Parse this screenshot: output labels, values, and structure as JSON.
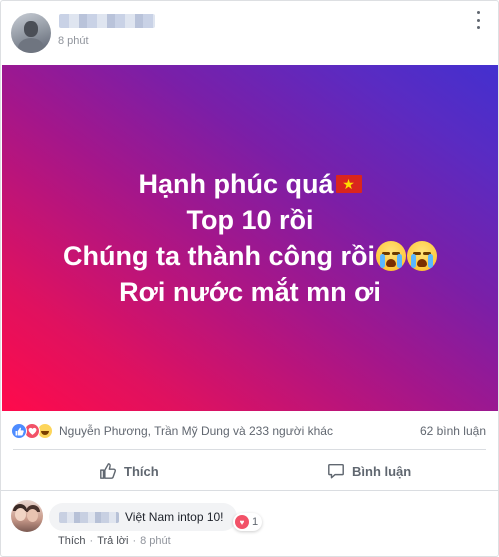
{
  "post": {
    "time": "8 phút",
    "banner_lines": [
      "Hạnh phúc quá",
      "Top 10 rồi",
      "Chúng ta thành công rồi",
      "Rơi nước mắt mn ơi"
    ]
  },
  "reactions": {
    "names": "Nguyễn Phương, Trần Mỹ Dung và 233 người khác",
    "comment_count": "62 bình luận",
    "types": [
      "like-icon",
      "love-icon",
      "haha-icon"
    ]
  },
  "actions": {
    "like_label": "Thích",
    "comment_label": "Bình luận"
  },
  "comment": {
    "text": "Việt Nam intop 10!",
    "reaction_count": "1",
    "like_link": "Thích",
    "reply_link": "Trả lời",
    "time": "8 phút"
  },
  "colors": {
    "like_blue": "#4e8cff",
    "love_red": "#f25268",
    "banner_gradient_start": "#ff0a4b",
    "banner_gradient_end": "#4330cf"
  }
}
